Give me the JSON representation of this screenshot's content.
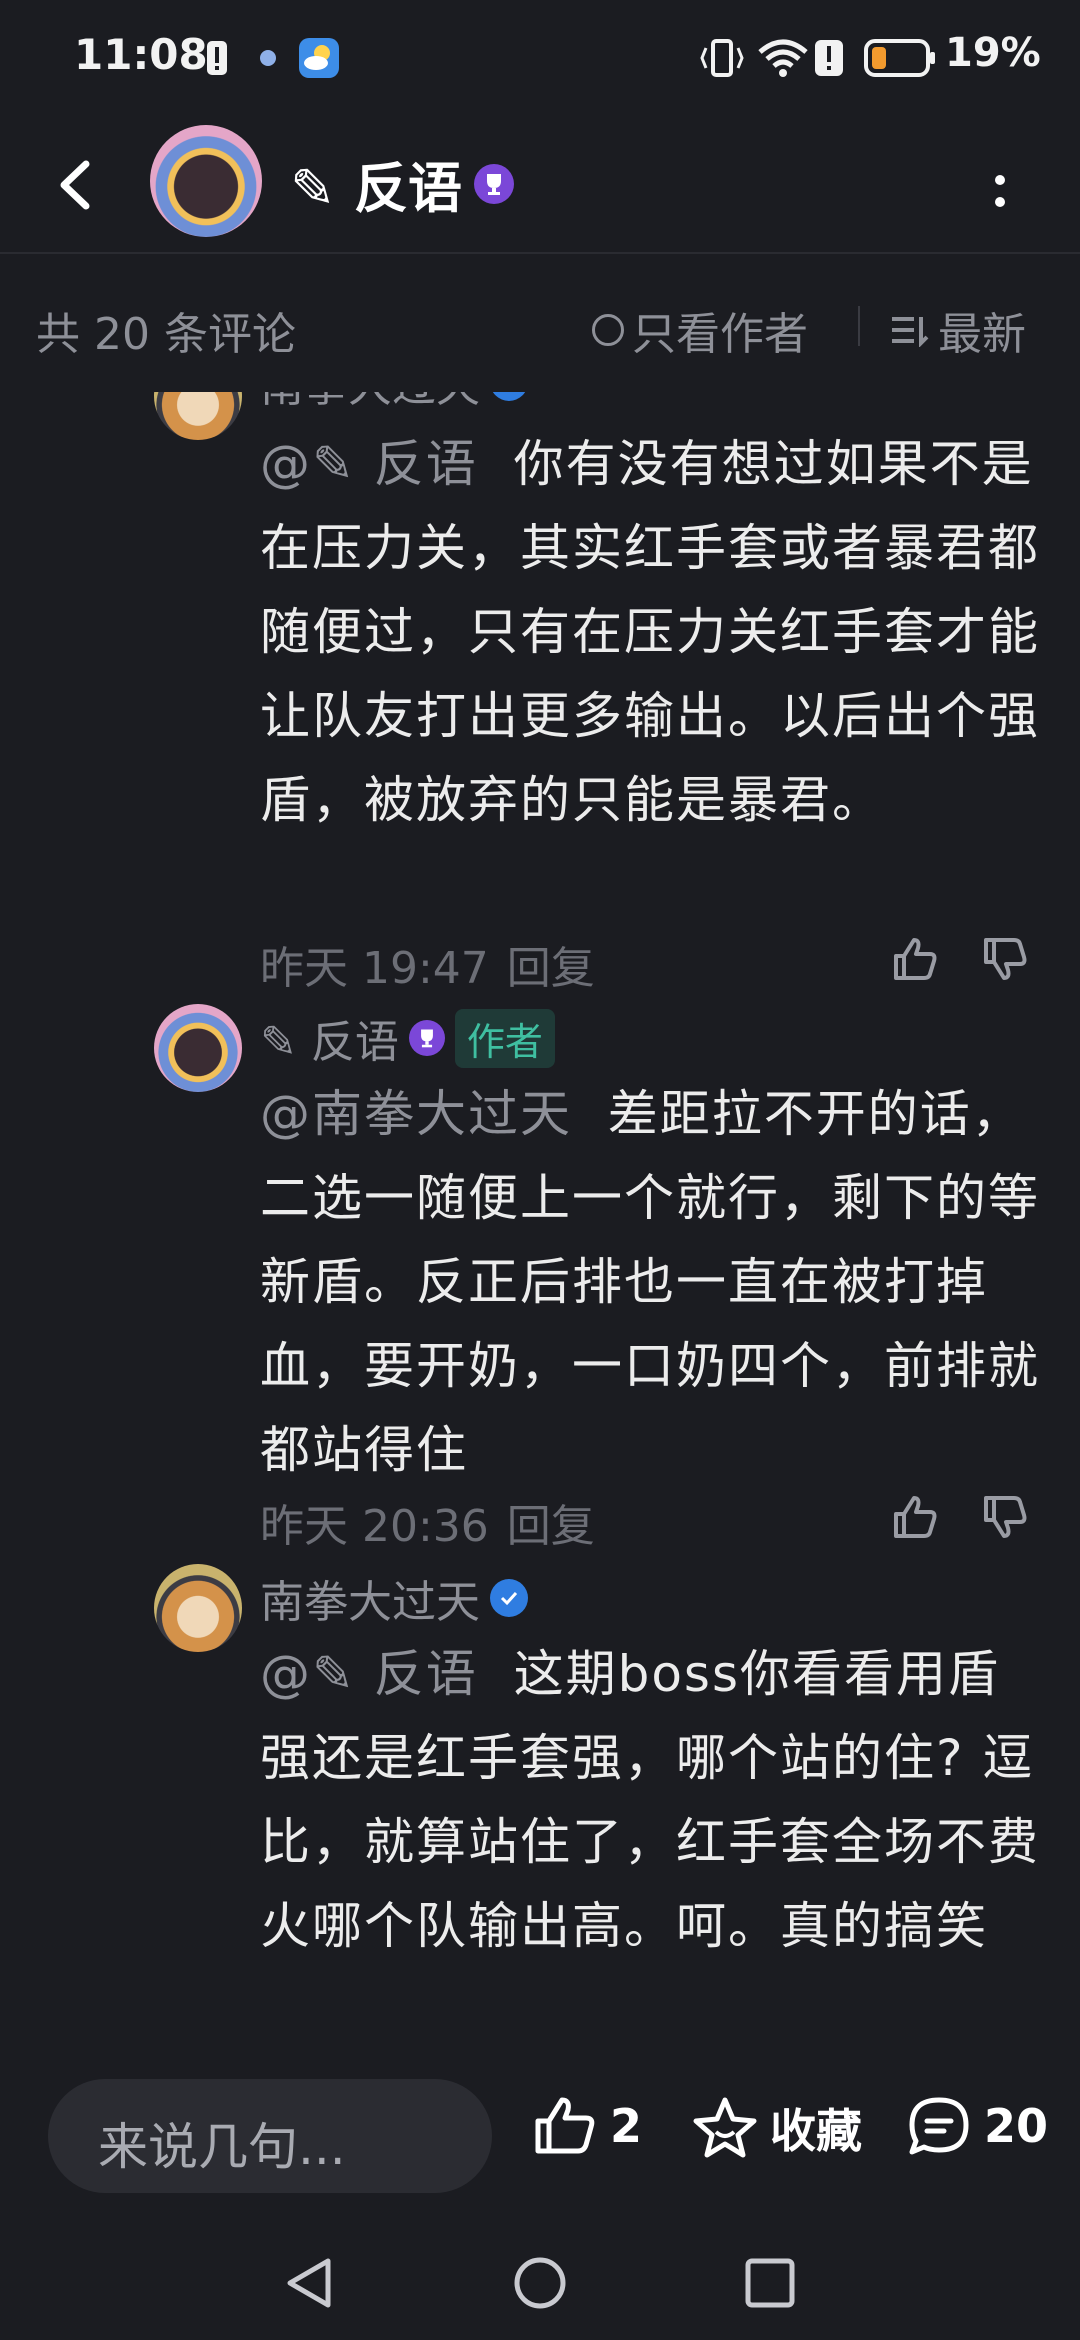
{
  "status_bar": {
    "time": "11:08",
    "battery": "19%"
  },
  "header": {
    "title": "✎ 反语",
    "more_label": "more"
  },
  "filter": {
    "count": "共 20 条评论",
    "only_author": "只看作者",
    "sort": "最新"
  },
  "comments": [
    {
      "author": "南拳大过天",
      "mention": "@✎ 反语",
      "text": "你有没有想过如果不是在压力关，其实红手套或者暴君都随便过，只有在压力关红手套才能让队友打出更多输出。以后出个强盾，被放弃的只能是暴君。",
      "time": "昨天 19:47",
      "reply": "回复"
    },
    {
      "author": "✎ 反语",
      "author_tag": "作者",
      "mention": "@南拳大过天",
      "text": "差距拉不开的话，二选一随便上一个就行，剩下的等新盾。反正后排也一直在被打掉血，要开奶，一口奶四个，前排就都站得住",
      "time": "昨天 20:36",
      "reply": "回复"
    },
    {
      "author": "南拳大过天",
      "mention": "@✎ 反语",
      "text": "这期boss你看看用盾强还是红手套强，哪个站的住? 逗比，就算站住了，红手套全场不费火哪个队输出高。呵。真的搞笑"
    }
  ],
  "bottom_bar": {
    "input_placeholder": "来说几句...",
    "like_count": "2",
    "collect_label": "收藏",
    "comment_count": "20"
  }
}
